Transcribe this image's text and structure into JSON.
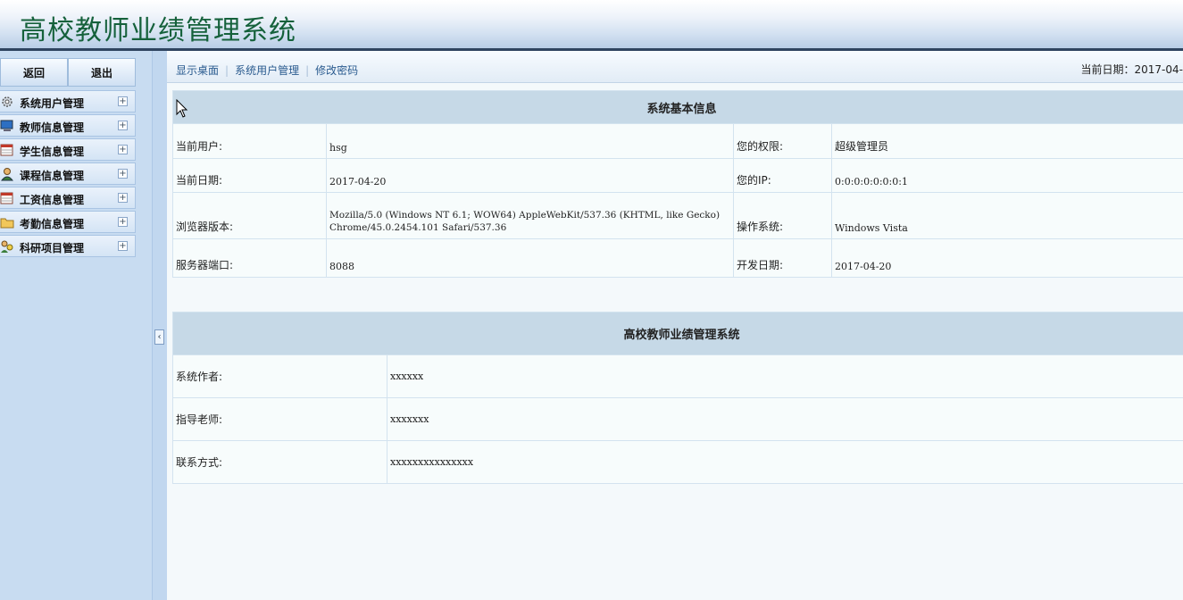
{
  "header": {
    "title": "高校教师业绩管理系统"
  },
  "left": {
    "back_label": "返回",
    "logout_label": "退出",
    "menu": [
      {
        "label": "系统用户管理",
        "icon": "gear-icon"
      },
      {
        "label": "教师信息管理",
        "icon": "computer-icon"
      },
      {
        "label": "学生信息管理",
        "icon": "calendar-icon"
      },
      {
        "label": "课程信息管理",
        "icon": "user-icon"
      },
      {
        "label": "工资信息管理",
        "icon": "calendar-icon"
      },
      {
        "label": "考勤信息管理",
        "icon": "folder-icon"
      },
      {
        "label": "科研项目管理",
        "icon": "users-icon"
      }
    ]
  },
  "toolbar": {
    "links": [
      "显示桌面",
      "系统用户管理",
      "修改密码"
    ],
    "date_label": "当前日期：2017-04-"
  },
  "sysinfo": {
    "title": "系统基本信息",
    "current_user_label": "当前用户:",
    "current_user": "hsg",
    "permission_label": "您的权限:",
    "permission": "超级管理员",
    "current_date_label": "当前日期:",
    "current_date": "2017-04-20",
    "ip_label": "您的IP:",
    "ip": "0:0:0:0:0:0:0:1",
    "browser_label": "浏览器版本:",
    "browser_line1": "Mozilla/5.0 (Windows NT 6.1; WOW64) AppleWebKit/537.36 (KHTML, like Gecko)",
    "browser_line2": "Chrome/45.0.2454.101 Safari/537.36",
    "os_label": "操作系统:",
    "os": "Windows Vista",
    "port_label": "服务器端口:",
    "port": "8088",
    "dev_date_label": "开发日期:",
    "dev_date": "2017-04-20"
  },
  "about": {
    "title": "高校教师业绩管理系统",
    "author_label": "系统作者:",
    "author": "xxxxxx",
    "advisor_label": "指导老师:",
    "advisor": "xxxxxxx",
    "contact_label": "联系方式:",
    "contact": "xxxxxxxxxxxxxxx"
  }
}
